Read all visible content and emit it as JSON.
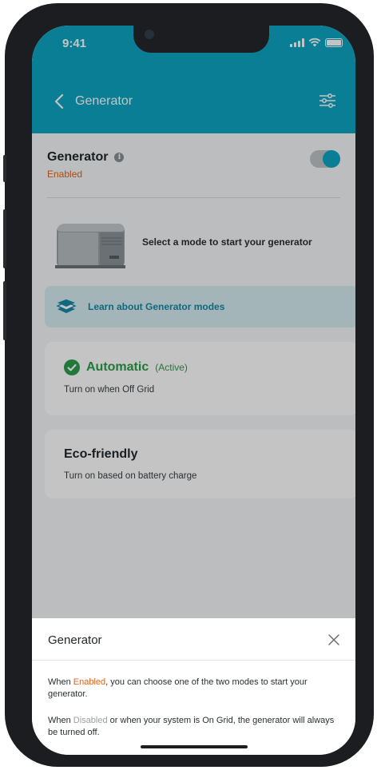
{
  "status_bar": {
    "time": "9:41"
  },
  "nav": {
    "title": "Generator"
  },
  "generator": {
    "title": "Generator",
    "status": "Enabled",
    "toggle_on": true,
    "hint": "Select a mode to start your generator"
  },
  "learn": {
    "label": "Learn about Generator modes"
  },
  "modes": [
    {
      "name": "Automatic",
      "tag": "(Active)",
      "description": "Turn on when Off Grid",
      "active": true
    },
    {
      "name": "Eco-friendly",
      "description": "Turn on based on battery charge",
      "active": false
    }
  ],
  "sheet": {
    "title": "Generator",
    "p1_before": "When ",
    "p1_highlight": "Enabled",
    "p1_after": ", you can choose one of the two modes to start your generator.",
    "p2_before": "When ",
    "p2_highlight": "Disabled",
    "p2_after": " or when your system is On Grid, the generator will always be turned off."
  },
  "colors": {
    "brand": "#0da5c2",
    "enabled": "#e3621b",
    "active": "#2a9e49",
    "disabled": "#9aa0a4"
  },
  "icons": [
    "back-chevron-icon",
    "filter-sliders-icon",
    "info-icon",
    "generator-image",
    "book-stack-icon",
    "check-circle-icon",
    "close-icon",
    "signal-icon",
    "wifi-icon",
    "battery-icon"
  ]
}
